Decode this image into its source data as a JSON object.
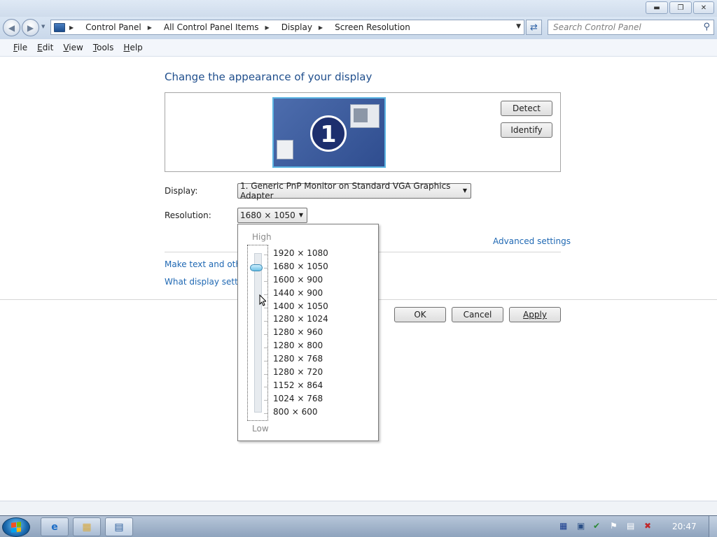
{
  "window": {
    "minimize_icon": "minimize-icon",
    "restore_icon": "restore-icon",
    "close_icon": "close-icon"
  },
  "address_bar": {
    "crumbs": [
      "Control Panel",
      "All Control Panel Items",
      "Display",
      "Screen Resolution"
    ],
    "search_placeholder": "Search Control Panel"
  },
  "menu": {
    "items": [
      {
        "label": "File",
        "accel": "F"
      },
      {
        "label": "Edit",
        "accel": "E"
      },
      {
        "label": "View",
        "accel": "V"
      },
      {
        "label": "Tools",
        "accel": "T"
      },
      {
        "label": "Help",
        "accel": "H"
      }
    ]
  },
  "main": {
    "heading": "Change the appearance of your display",
    "monitor_number": "1",
    "detect_label": "Detect",
    "identify_label": "Identify",
    "display_label": "Display:",
    "display_value": "1. Generic PnP Monitor on Standard VGA Graphics Adapter",
    "resolution_label": "Resolution:",
    "resolution_value": "1680 × 1050",
    "advanced_link": "Advanced settings",
    "link_text_size": "Make text and other",
    "link_display_settings": "What display setting",
    "ok_label": "OK",
    "cancel_label": "Cancel",
    "apply_label": "Apply"
  },
  "resolution_dropdown": {
    "high_label": "High",
    "low_label": "Low",
    "options": [
      "1920 × 1080",
      "1680 × 1050",
      "1600 × 900",
      "1440 × 900",
      "1400 × 1050",
      "1280 × 1024",
      "1280 × 960",
      "1280 × 800",
      "1280 × 768",
      "1280 × 720",
      "1152 × 864",
      "1024 × 768",
      "800 × 600"
    ],
    "selected_index": 1
  },
  "taskbar": {
    "clock": "20:47"
  }
}
